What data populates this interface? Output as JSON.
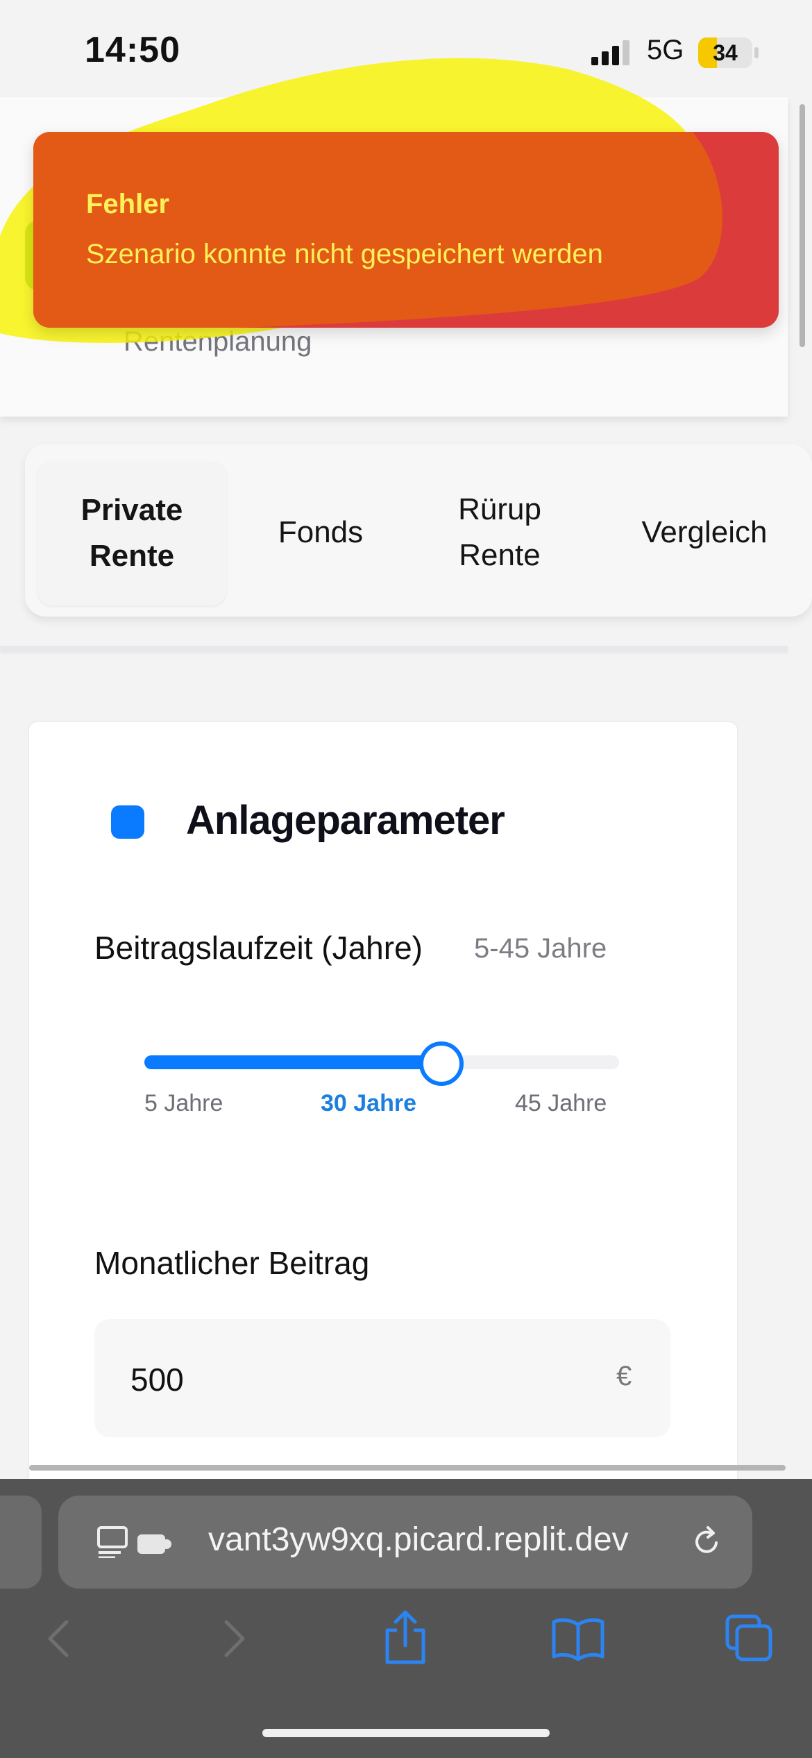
{
  "status_bar": {
    "time": "14:50",
    "network": "5G",
    "battery_level": "34",
    "signal_icon": "cellular-signal-icon"
  },
  "header": {
    "subtitle": "Rentenplanung",
    "badge_color": "#2f9b43"
  },
  "toast": {
    "title": "Fehler",
    "message": "Szenario konnte nicht gespeichert werden",
    "background_color": "#dc3b3b",
    "text_color": "#fff15a"
  },
  "tabs": [
    {
      "label": "Private\nRente",
      "active": true
    },
    {
      "label": "Fonds",
      "active": false
    },
    {
      "label": "Rürup\nRente",
      "active": false
    },
    {
      "label": "Vergleich",
      "active": false
    }
  ],
  "parameters": {
    "heading": "Anlageparameter",
    "accent_color": "#0a7bff",
    "duration": {
      "label": "Beitragslaufzeit (Jahre)",
      "range_hint": "5-45 Jahre",
      "min_label": "5 Jahre",
      "max_label": "45 Jahre",
      "value_label": "30 Jahre",
      "min": 5,
      "max": 45,
      "value": 30
    },
    "contribution": {
      "label": "Monatlicher Beitrag",
      "value": "500",
      "currency": "€"
    }
  },
  "browser": {
    "url": "vant3yw9xq.picard.replit.dev",
    "icons": [
      "reader-icon",
      "extension-icon",
      "reload-icon",
      "back-icon",
      "forward-icon",
      "share-icon",
      "bookmarks-icon",
      "tabs-icon"
    ]
  }
}
